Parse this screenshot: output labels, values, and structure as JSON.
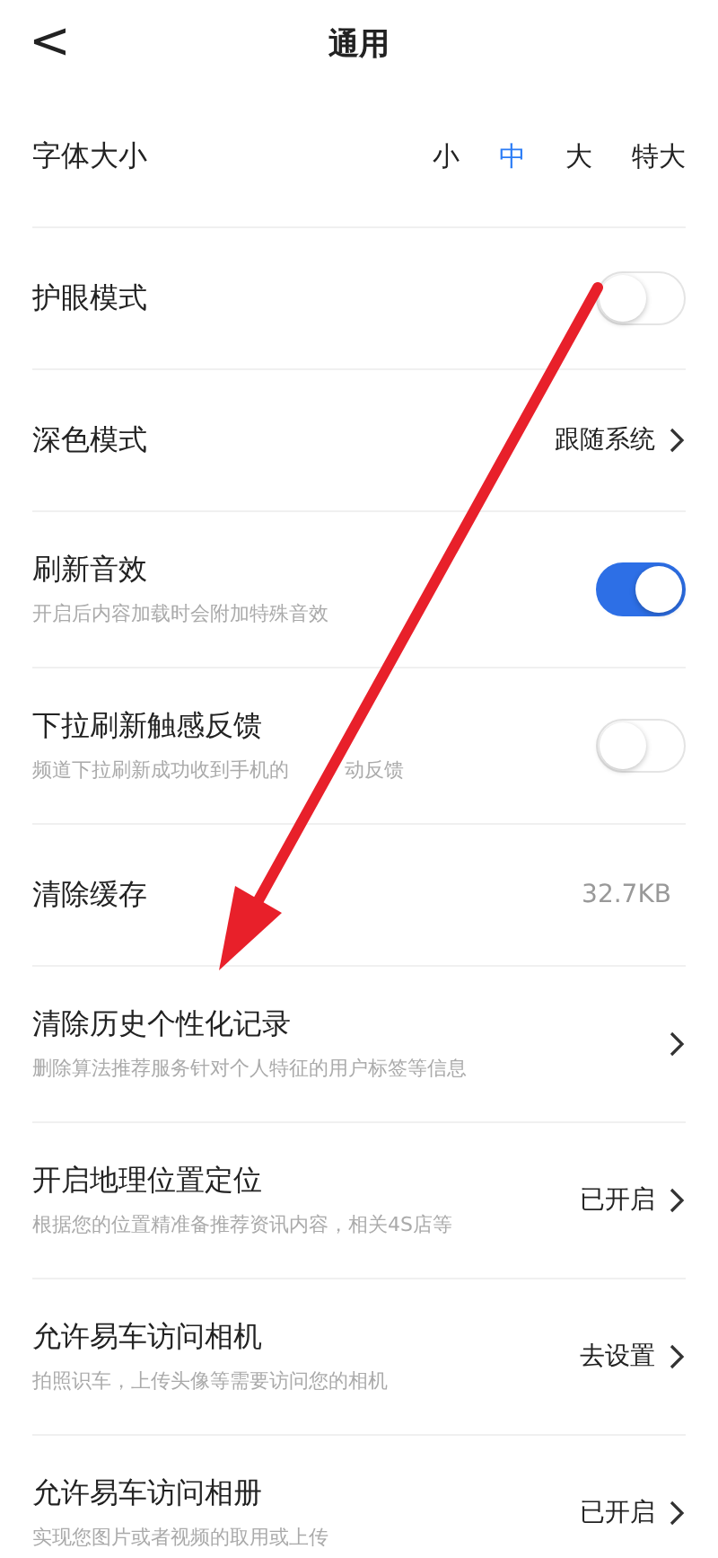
{
  "header": {
    "back": "<",
    "title": "通用"
  },
  "rows": [
    {
      "kind": "choice",
      "title": "字体大小",
      "options": [
        {
          "label": "小",
          "selected": false
        },
        {
          "label": "中",
          "selected": true
        },
        {
          "label": "大",
          "selected": false
        },
        {
          "label": "特大",
          "selected": false
        }
      ]
    },
    {
      "kind": "toggle",
      "title": "护眼模式",
      "on": false
    },
    {
      "kind": "link",
      "title": "深色模式",
      "value": "跟随系统"
    },
    {
      "kind": "toggle",
      "title": "刷新音效",
      "subtitle": "开启后内容加载时会附加特殊音效",
      "on": true
    },
    {
      "kind": "toggle",
      "title": "下拉刷新触感反馈",
      "subtitle": "频道下拉刷新成功收到手机的",
      "subtitle_rest": "动反馈",
      "on": false
    },
    {
      "kind": "value",
      "title": "清除缓存",
      "value": "32.7KB"
    },
    {
      "kind": "link",
      "title": "清除历史个性化记录",
      "subtitle": "删除算法推荐服务针对个人特征的用户标签等信息"
    },
    {
      "kind": "link",
      "title": "开启地理位置定位",
      "subtitle": "根据您的位置精准备推荐资讯内容，相关4S店等",
      "value": "已开启"
    },
    {
      "kind": "link",
      "title": "允许易车访问相机",
      "subtitle": "拍照识车，上传头像等需要访问您的相机",
      "value": "去设置"
    },
    {
      "kind": "link",
      "title": "允许易车访问相册",
      "subtitle": "实现您图片或者视频的取用或上传",
      "value": "已开启"
    }
  ]
}
